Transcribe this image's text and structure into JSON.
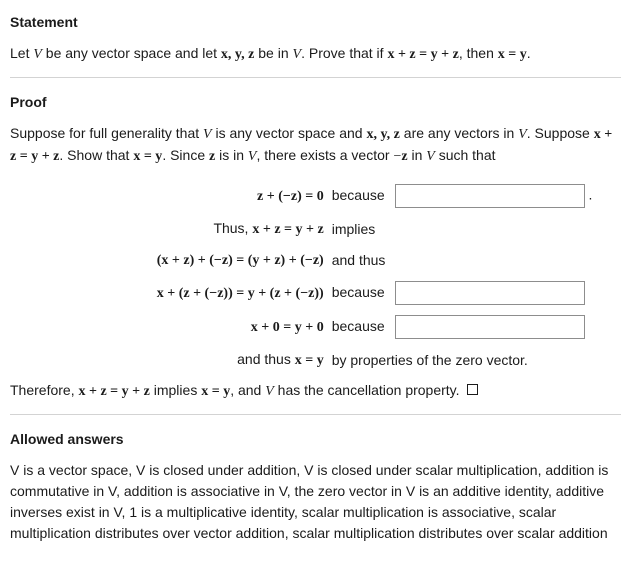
{
  "headings": {
    "statement": "Statement",
    "proof": "Proof",
    "allowed": "Allowed answers"
  },
  "statement": {
    "pre": "Let ",
    "V": "V",
    "mid1": " be any vector space and let ",
    "vars": "x, y, z",
    "mid2": " be in ",
    "mid3": ". Prove that if ",
    "eq1": "x + z = y + z",
    "mid4": ", then ",
    "eq2": "x = y",
    "end": "."
  },
  "proof_intro": {
    "t1": "Suppose for full generality that ",
    "t2": " is any vector space and ",
    "t3": " are any vectors in ",
    "t4": ". Suppose ",
    "eq_sup": "x + z = y + z",
    "t5": ". Show that ",
    "eq_goal": "x = y",
    "t6": ". Since ",
    "zvar": "z",
    "t7": " is in ",
    "t8": ", there exists a vector ",
    "negz": "−z",
    "t9": " in ",
    "t10": " such that"
  },
  "lines": {
    "l1_eq": "z + (−z) = 0",
    "l1_reason_label": "because",
    "l1_after": ".",
    "l2_prefix": "Thus, ",
    "l2_eq": "x + z = y + z",
    "l2_reason": "implies",
    "l3_eq": "(x + z) + (−z) = (y + z) + (−z)",
    "l3_reason": "and thus",
    "l4_eq": "x + (z + (−z)) = y + (z + (−z))",
    "l4_reason_label": "because",
    "l5_eq": "x + 0 = y + 0",
    "l5_reason_label": "because",
    "l6_prefix": "and thus ",
    "l6_eq": "x = y",
    "l6_reason": "by properties of the zero vector."
  },
  "conclusion": {
    "t1": "Therefore, ",
    "eq1": "x + z = y + z",
    "t2": " implies ",
    "eq2": "x = y",
    "t3": ", and ",
    "t4": " has the cancellation property. "
  },
  "allowed_text": "V is a vector space, V is closed under addition, V is closed under scalar multiplication, addition is commutative in V, addition is associative in V, the zero vector in V is an additive identity, additive inverses exist in V, 1 is a multiplicative identity, scalar multiplication is associative, scalar multiplication distributes over vector addition, scalar multiplication distributes over scalar addition"
}
